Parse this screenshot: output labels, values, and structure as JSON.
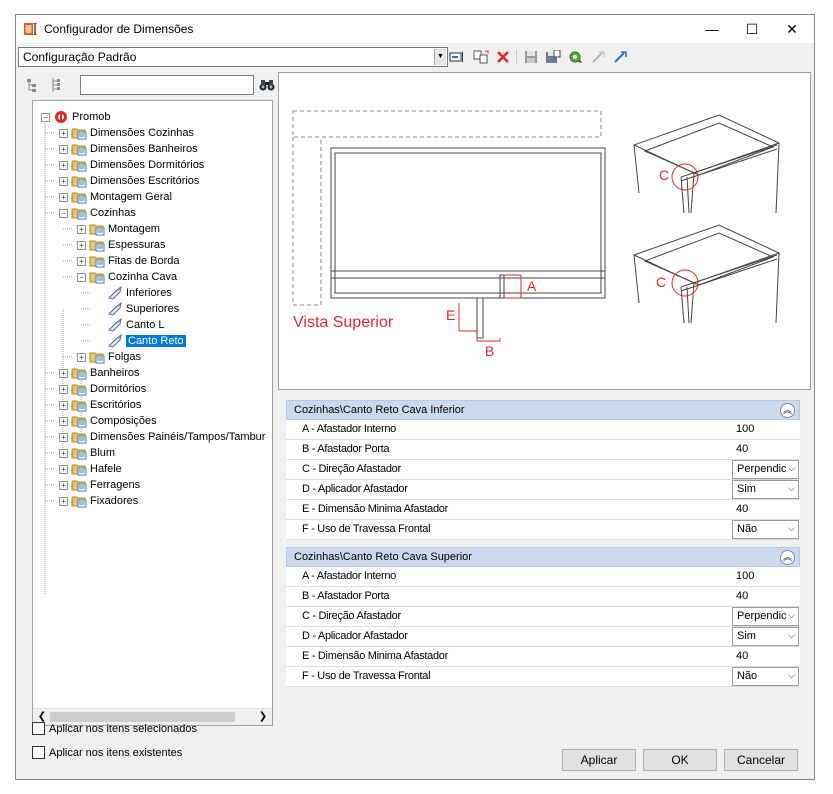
{
  "window": {
    "title": "Configurador de Dimensões",
    "minimize": "—",
    "maximize": "☐",
    "close": "✕"
  },
  "config": {
    "selected": "Configuração Padrão"
  },
  "tree": {
    "search_placeholder": "",
    "items": [
      {
        "label": "Promob",
        "level": 0,
        "icon": "promob"
      },
      {
        "label": "Dimensões Cozinhas",
        "level": 1,
        "icon": "folder"
      },
      {
        "label": "Dimensões Banheiros",
        "level": 1,
        "icon": "folder"
      },
      {
        "label": "Dimensões Dormitórios",
        "level": 1,
        "icon": "folder"
      },
      {
        "label": "Dimensões Escritórios",
        "level": 1,
        "icon": "folder"
      },
      {
        "label": "Montagem Geral",
        "level": 1,
        "icon": "folder"
      },
      {
        "label": "Cozinhas",
        "level": 1,
        "icon": "folder",
        "expanded": true
      },
      {
        "label": "Montagem",
        "level": 2,
        "icon": "folder"
      },
      {
        "label": "Espessuras",
        "level": 2,
        "icon": "folder"
      },
      {
        "label": "Fitas de Borda",
        "level": 2,
        "icon": "folder"
      },
      {
        "label": "Cozinha Cava",
        "level": 2,
        "icon": "folder",
        "expanded": true
      },
      {
        "label": "Inferiores",
        "level": 3,
        "icon": "tag"
      },
      {
        "label": "Superiores",
        "level": 3,
        "icon": "tag"
      },
      {
        "label": "Canto L",
        "level": 3,
        "icon": "tag"
      },
      {
        "label": "Canto Reto",
        "level": 3,
        "icon": "tag",
        "selected": true
      },
      {
        "label": "Folgas",
        "level": 2,
        "icon": "folder"
      },
      {
        "label": "Banheiros",
        "level": 1,
        "icon": "folder"
      },
      {
        "label": "Dormitórios",
        "level": 1,
        "icon": "folder"
      },
      {
        "label": "Escritórios",
        "level": 1,
        "icon": "folder"
      },
      {
        "label": "Composições",
        "level": 1,
        "icon": "folder"
      },
      {
        "label": "Dimensões Painéis/Tampos/Tambur",
        "level": 1,
        "icon": "folder"
      },
      {
        "label": "Blum",
        "level": 1,
        "icon": "folder"
      },
      {
        "label": "Hafele",
        "level": 1,
        "icon": "folder"
      },
      {
        "label": "Ferragens",
        "level": 1,
        "icon": "folder"
      },
      {
        "label": "Fixadores",
        "level": 1,
        "icon": "folder"
      }
    ]
  },
  "preview": {
    "view_label": "Vista Superior",
    "dim_a": "A",
    "dim_b": "B",
    "dim_c_top": "C",
    "dim_c_bottom": "C",
    "dim_e": "E"
  },
  "groups": [
    {
      "title": "Cozinhas\\Canto Reto Cava Inferior",
      "rows": [
        {
          "name": "A -  Afastador Interno",
          "value": "100",
          "dropdown": false
        },
        {
          "name": "B - Afastador Porta",
          "value": "40",
          "dropdown": false
        },
        {
          "name": "C - Direção Afastador",
          "value": "Perpendic",
          "dropdown": true
        },
        {
          "name": "D - Aplicador Afastador",
          "value": "Sim",
          "dropdown": true
        },
        {
          "name": "E - Dimensão Minima Afastador",
          "value": "40",
          "dropdown": false
        },
        {
          "name": "F -  Uso de Travessa Frontal",
          "value": "Não",
          "dropdown": true
        }
      ]
    },
    {
      "title": "Cozinhas\\Canto Reto Cava Superior",
      "rows": [
        {
          "name": "A -  Afastador Interno",
          "value": "100",
          "dropdown": false
        },
        {
          "name": "B - Afastador Porta",
          "value": "40",
          "dropdown": false
        },
        {
          "name": "C - Direção Afastador",
          "value": "Perpendic",
          "dropdown": true
        },
        {
          "name": "D - Aplicador Afastador",
          "value": "Sim",
          "dropdown": true
        },
        {
          "name": "E - Dimensão Minima Afastador",
          "value": "40",
          "dropdown": false
        },
        {
          "name": "F -  Uso de Travessa Frontal",
          "value": "Não",
          "dropdown": true
        }
      ]
    }
  ],
  "options": {
    "apply_selected": "Aplicar nos itens selecionados",
    "apply_existing": "Aplicar nos itens existentes"
  },
  "buttons": {
    "apply": "Aplicar",
    "ok": "OK",
    "cancel": "Cancelar"
  },
  "colors": {
    "accent": "#0078d7",
    "dimension_red": "#e0282c",
    "group_header": "#cbd9ee"
  },
  "icons": {
    "toolbar": [
      "rename-icon",
      "copy-config-icon",
      "delete-icon",
      "save-icon",
      "save-as-icon",
      "settings-icon",
      "import-icon",
      "export-icon"
    ],
    "tree_tools": [
      "collapse-all-icon",
      "expand-all-icon",
      "binoculars-icon"
    ]
  }
}
